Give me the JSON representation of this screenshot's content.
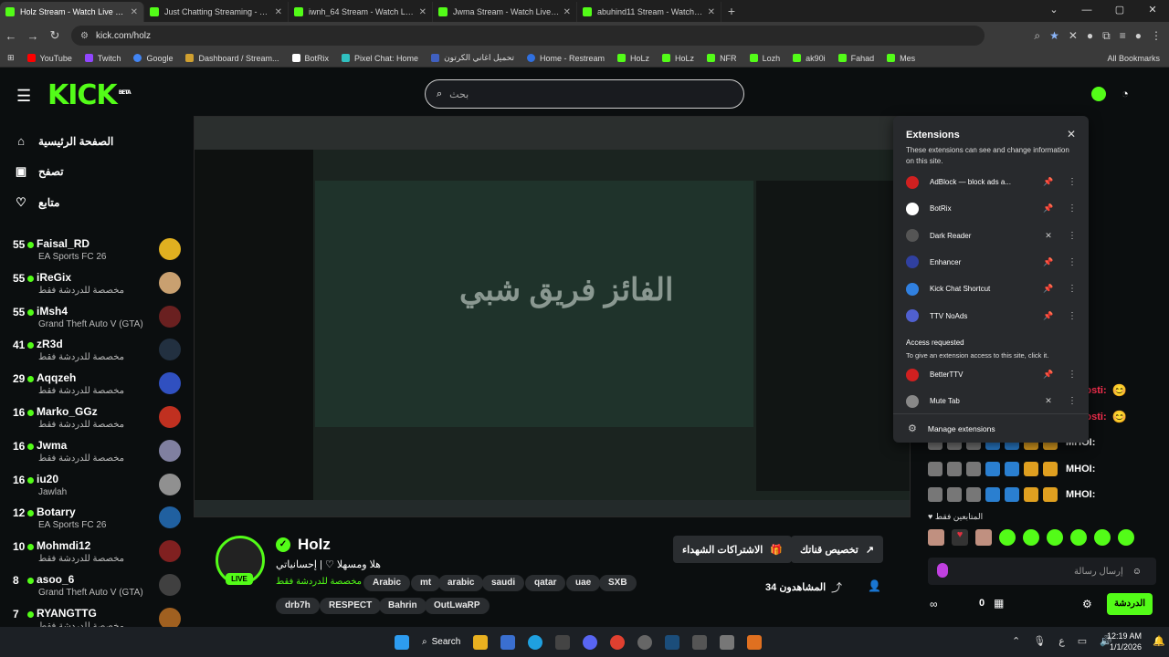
{
  "browser": {
    "tabs": [
      {
        "title": "Holz Stream - Watch Live on Kick",
        "active": true
      },
      {
        "title": "Just Chatting Streaming - Live S",
        "active": false
      },
      {
        "title": "iwnh_64 Stream - Watch Live on",
        "active": false
      },
      {
        "title": "Jwma Stream - Watch Live on K",
        "active": false
      },
      {
        "title": "abuhind11 Stream - Watch Live",
        "active": false
      }
    ],
    "url": "kick.com/holz",
    "bookmarks": [
      "YouTube",
      "Twitch",
      "Google",
      "Dashboard / Stream...",
      "BotRix",
      "Pixel Chat: Home",
      "تحميل اغاني الكرتون",
      "Home - Restream",
      "HoLz",
      "HoLz",
      "NFR",
      "Lozh",
      "ak90i",
      "Fahad",
      "Mes"
    ],
    "all_bookmarks": "All Bookmarks"
  },
  "header": {
    "logo": "KICK",
    "logo_badge": "BETA",
    "search_placeholder": "بحث"
  },
  "nav": [
    {
      "label": "الصفحة الرئيسية",
      "icon": "home-icon"
    },
    {
      "label": "تصفح",
      "icon": "browse-icon"
    },
    {
      "label": "متابع",
      "icon": "heart-icon"
    }
  ],
  "sidebar": [
    {
      "count": "55",
      "name": "Faisal_RD",
      "game": "EA Sports FC 26",
      "color": "#e0b020"
    },
    {
      "count": "55",
      "name": "iReGix",
      "game": "مخصصة للدردشة فقط",
      "color": "#c9a070"
    },
    {
      "count": "55",
      "name": "iMsh4",
      "game": "Grand Theft Auto V (GTA)",
      "color": "#6a2020"
    },
    {
      "count": "41",
      "name": "zR3d",
      "game": "مخصصة للدردشة فقط",
      "color": "#223040"
    },
    {
      "count": "29",
      "name": "Aqqzeh",
      "game": "مخصصة للدردشة فقط",
      "color": "#3050c0"
    },
    {
      "count": "16",
      "name": "Marko_GGz",
      "game": "مخصصة للدردشة فقط",
      "color": "#c03020"
    },
    {
      "count": "16",
      "name": "Jwma",
      "game": "مخصصة للدردشة فقط",
      "color": "#8080a0"
    },
    {
      "count": "16",
      "name": "iu20",
      "game": "Jawlah",
      "color": "#909090"
    },
    {
      "count": "12",
      "name": "Botarry",
      "game": "EA Sports FC 26",
      "color": "#2060a0"
    },
    {
      "count": "10",
      "name": "Mohmdi12",
      "game": "مخصصة للدردشة فقط",
      "color": "#802020"
    },
    {
      "count": "8",
      "name": "asoo_6",
      "game": "Grand Theft Auto V (GTA)",
      "color": "#404040"
    },
    {
      "count": "7",
      "name": "RYANGTTG",
      "game": "مخصصة للدردشة فقط",
      "color": "#a06020"
    }
  ],
  "screen": {
    "overlay_text": "الفائز فريق شبي"
  },
  "channel": {
    "name": "Holz",
    "live": "LIVE",
    "title": "هلا ومسهلا ♡ | إحسانياتي",
    "category": "مخصصة للدردشة فقط",
    "tags": [
      "Arabic",
      "mt",
      "arabic",
      "saudi",
      "qatar",
      "uae",
      "SXB",
      "drb7h",
      "RESPECT",
      "Bahrin",
      "OutLwaRP"
    ],
    "subscribe_gifts": "الاشتراكات الشهداء",
    "customize": "تخصيص قناتك",
    "viewers_count": "34",
    "viewers_label": "المشاهدون"
  },
  "chat": {
    "lines": [
      {
        "user": "1Ghosti:",
        "color": "#ff3050",
        "emote": "😊"
      },
      {
        "user": "1Ghosti:",
        "color": "#ff3050",
        "emote": "😊"
      },
      {
        "user": "MHOI:",
        "color": "#ffffff",
        "emote": ""
      },
      {
        "user": "MHOI:",
        "color": "#ffffff",
        "emote": ""
      },
      {
        "user": "MHOI:",
        "color": "#ffffff",
        "emote": ""
      }
    ],
    "followers_only": "المتابعين فقط",
    "input_placeholder": "إرسال رسالة",
    "send": "الدردشة",
    "points": "0"
  },
  "extensions": {
    "title": "Extensions",
    "description": "These extensions can see and change information on this site.",
    "items": [
      {
        "name": "AdBlock — block ads a...",
        "color": "#d02020",
        "pinned": true
      },
      {
        "name": "BotRix",
        "color": "#ffffff",
        "pinned": true
      },
      {
        "name": "Dark Reader",
        "color": "#555555",
        "pinned": false
      },
      {
        "name": "Enhancer",
        "color": "#3040a0",
        "pinned": true
      },
      {
        "name": "Kick Chat Shortcut",
        "color": "#3080e0",
        "pinned": true
      },
      {
        "name": "TTV NoAds",
        "color": "#5060d0",
        "pinned": true
      }
    ],
    "requested_title": "Access requested",
    "requested_desc": "To give an extension access to this site, click it.",
    "requested": [
      {
        "name": "BetterTTV",
        "color": "#d02020",
        "pinned": true
      },
      {
        "name": "Mute Tab",
        "color": "#888888",
        "pinned": false
      }
    ],
    "manage": "Manage extensions"
  },
  "taskbar": {
    "search": "Search",
    "time": "12:19 AM",
    "date": "1/1/2026"
  }
}
